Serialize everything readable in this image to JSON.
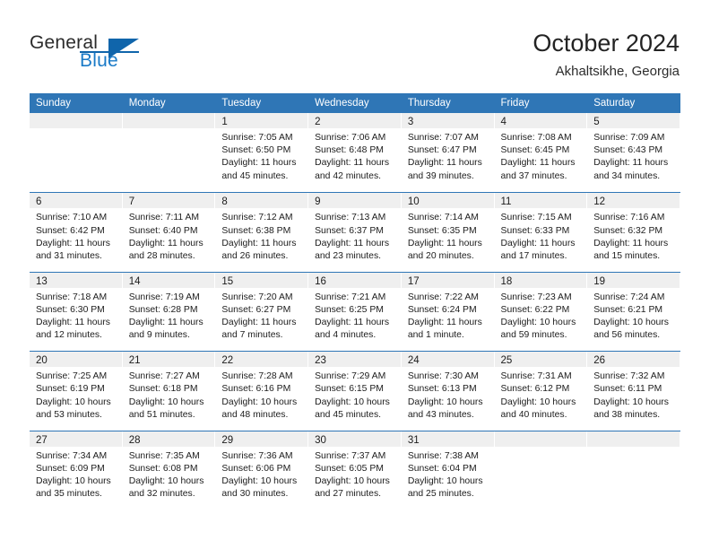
{
  "logo": {
    "word_top": "General",
    "word_bottom": "Blue",
    "accent_color": "#1065ab",
    "text_color": "#2b2b2b"
  },
  "header": {
    "title": "October 2024",
    "subtitle": "Akhaltsikhe, Georgia",
    "header_bar_color": "#2f76b6",
    "day_band_color": "#efefef"
  },
  "weekday_headers": [
    "Sunday",
    "Monday",
    "Tuesday",
    "Wednesday",
    "Thursday",
    "Friday",
    "Saturday"
  ],
  "weeks": [
    [
      {
        "day": "",
        "sunrise": "",
        "sunset": "",
        "daylight_1": "",
        "daylight_2": ""
      },
      {
        "day": "",
        "sunrise": "",
        "sunset": "",
        "daylight_1": "",
        "daylight_2": ""
      },
      {
        "day": "1",
        "sunrise": "Sunrise: 7:05 AM",
        "sunset": "Sunset: 6:50 PM",
        "daylight_1": "Daylight: 11 hours",
        "daylight_2": "and 45 minutes."
      },
      {
        "day": "2",
        "sunrise": "Sunrise: 7:06 AM",
        "sunset": "Sunset: 6:48 PM",
        "daylight_1": "Daylight: 11 hours",
        "daylight_2": "and 42 minutes."
      },
      {
        "day": "3",
        "sunrise": "Sunrise: 7:07 AM",
        "sunset": "Sunset: 6:47 PM",
        "daylight_1": "Daylight: 11 hours",
        "daylight_2": "and 39 minutes."
      },
      {
        "day": "4",
        "sunrise": "Sunrise: 7:08 AM",
        "sunset": "Sunset: 6:45 PM",
        "daylight_1": "Daylight: 11 hours",
        "daylight_2": "and 37 minutes."
      },
      {
        "day": "5",
        "sunrise": "Sunrise: 7:09 AM",
        "sunset": "Sunset: 6:43 PM",
        "daylight_1": "Daylight: 11 hours",
        "daylight_2": "and 34 minutes."
      }
    ],
    [
      {
        "day": "6",
        "sunrise": "Sunrise: 7:10 AM",
        "sunset": "Sunset: 6:42 PM",
        "daylight_1": "Daylight: 11 hours",
        "daylight_2": "and 31 minutes."
      },
      {
        "day": "7",
        "sunrise": "Sunrise: 7:11 AM",
        "sunset": "Sunset: 6:40 PM",
        "daylight_1": "Daylight: 11 hours",
        "daylight_2": "and 28 minutes."
      },
      {
        "day": "8",
        "sunrise": "Sunrise: 7:12 AM",
        "sunset": "Sunset: 6:38 PM",
        "daylight_1": "Daylight: 11 hours",
        "daylight_2": "and 26 minutes."
      },
      {
        "day": "9",
        "sunrise": "Sunrise: 7:13 AM",
        "sunset": "Sunset: 6:37 PM",
        "daylight_1": "Daylight: 11 hours",
        "daylight_2": "and 23 minutes."
      },
      {
        "day": "10",
        "sunrise": "Sunrise: 7:14 AM",
        "sunset": "Sunset: 6:35 PM",
        "daylight_1": "Daylight: 11 hours",
        "daylight_2": "and 20 minutes."
      },
      {
        "day": "11",
        "sunrise": "Sunrise: 7:15 AM",
        "sunset": "Sunset: 6:33 PM",
        "daylight_1": "Daylight: 11 hours",
        "daylight_2": "and 17 minutes."
      },
      {
        "day": "12",
        "sunrise": "Sunrise: 7:16 AM",
        "sunset": "Sunset: 6:32 PM",
        "daylight_1": "Daylight: 11 hours",
        "daylight_2": "and 15 minutes."
      }
    ],
    [
      {
        "day": "13",
        "sunrise": "Sunrise: 7:18 AM",
        "sunset": "Sunset: 6:30 PM",
        "daylight_1": "Daylight: 11 hours",
        "daylight_2": "and 12 minutes."
      },
      {
        "day": "14",
        "sunrise": "Sunrise: 7:19 AM",
        "sunset": "Sunset: 6:28 PM",
        "daylight_1": "Daylight: 11 hours",
        "daylight_2": "and 9 minutes."
      },
      {
        "day": "15",
        "sunrise": "Sunrise: 7:20 AM",
        "sunset": "Sunset: 6:27 PM",
        "daylight_1": "Daylight: 11 hours",
        "daylight_2": "and 7 minutes."
      },
      {
        "day": "16",
        "sunrise": "Sunrise: 7:21 AM",
        "sunset": "Sunset: 6:25 PM",
        "daylight_1": "Daylight: 11 hours",
        "daylight_2": "and 4 minutes."
      },
      {
        "day": "17",
        "sunrise": "Sunrise: 7:22 AM",
        "sunset": "Sunset: 6:24 PM",
        "daylight_1": "Daylight: 11 hours",
        "daylight_2": "and 1 minute."
      },
      {
        "day": "18",
        "sunrise": "Sunrise: 7:23 AM",
        "sunset": "Sunset: 6:22 PM",
        "daylight_1": "Daylight: 10 hours",
        "daylight_2": "and 59 minutes."
      },
      {
        "day": "19",
        "sunrise": "Sunrise: 7:24 AM",
        "sunset": "Sunset: 6:21 PM",
        "daylight_1": "Daylight: 10 hours",
        "daylight_2": "and 56 minutes."
      }
    ],
    [
      {
        "day": "20",
        "sunrise": "Sunrise: 7:25 AM",
        "sunset": "Sunset: 6:19 PM",
        "daylight_1": "Daylight: 10 hours",
        "daylight_2": "and 53 minutes."
      },
      {
        "day": "21",
        "sunrise": "Sunrise: 7:27 AM",
        "sunset": "Sunset: 6:18 PM",
        "daylight_1": "Daylight: 10 hours",
        "daylight_2": "and 51 minutes."
      },
      {
        "day": "22",
        "sunrise": "Sunrise: 7:28 AM",
        "sunset": "Sunset: 6:16 PM",
        "daylight_1": "Daylight: 10 hours",
        "daylight_2": "and 48 minutes."
      },
      {
        "day": "23",
        "sunrise": "Sunrise: 7:29 AM",
        "sunset": "Sunset: 6:15 PM",
        "daylight_1": "Daylight: 10 hours",
        "daylight_2": "and 45 minutes."
      },
      {
        "day": "24",
        "sunrise": "Sunrise: 7:30 AM",
        "sunset": "Sunset: 6:13 PM",
        "daylight_1": "Daylight: 10 hours",
        "daylight_2": "and 43 minutes."
      },
      {
        "day": "25",
        "sunrise": "Sunrise: 7:31 AM",
        "sunset": "Sunset: 6:12 PM",
        "daylight_1": "Daylight: 10 hours",
        "daylight_2": "and 40 minutes."
      },
      {
        "day": "26",
        "sunrise": "Sunrise: 7:32 AM",
        "sunset": "Sunset: 6:11 PM",
        "daylight_1": "Daylight: 10 hours",
        "daylight_2": "and 38 minutes."
      }
    ],
    [
      {
        "day": "27",
        "sunrise": "Sunrise: 7:34 AM",
        "sunset": "Sunset: 6:09 PM",
        "daylight_1": "Daylight: 10 hours",
        "daylight_2": "and 35 minutes."
      },
      {
        "day": "28",
        "sunrise": "Sunrise: 7:35 AM",
        "sunset": "Sunset: 6:08 PM",
        "daylight_1": "Daylight: 10 hours",
        "daylight_2": "and 32 minutes."
      },
      {
        "day": "29",
        "sunrise": "Sunrise: 7:36 AM",
        "sunset": "Sunset: 6:06 PM",
        "daylight_1": "Daylight: 10 hours",
        "daylight_2": "and 30 minutes."
      },
      {
        "day": "30",
        "sunrise": "Sunrise: 7:37 AM",
        "sunset": "Sunset: 6:05 PM",
        "daylight_1": "Daylight: 10 hours",
        "daylight_2": "and 27 minutes."
      },
      {
        "day": "31",
        "sunrise": "Sunrise: 7:38 AM",
        "sunset": "Sunset: 6:04 PM",
        "daylight_1": "Daylight: 10 hours",
        "daylight_2": "and 25 minutes."
      },
      {
        "day": "",
        "sunrise": "",
        "sunset": "",
        "daylight_1": "",
        "daylight_2": ""
      },
      {
        "day": "",
        "sunrise": "",
        "sunset": "",
        "daylight_1": "",
        "daylight_2": ""
      }
    ]
  ]
}
